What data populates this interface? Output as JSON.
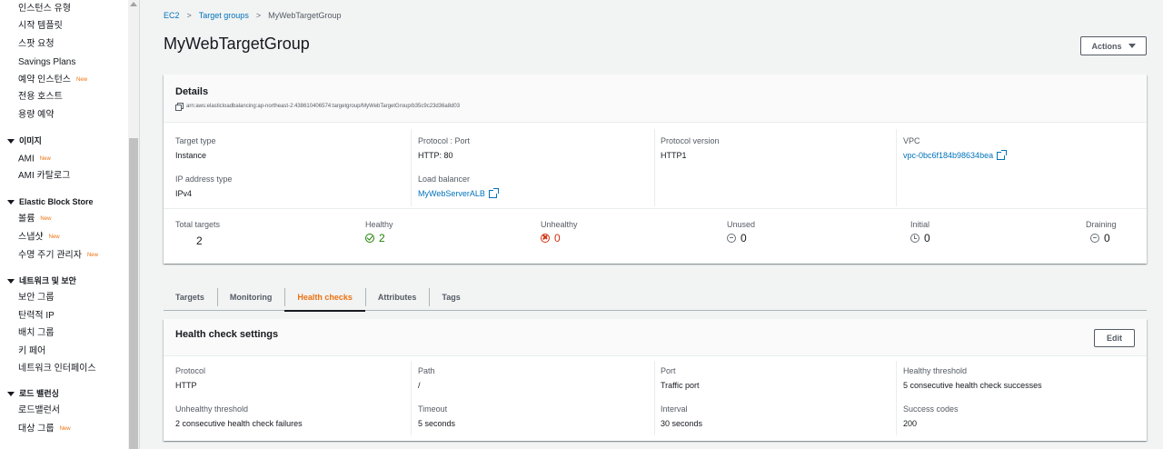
{
  "sidebar": {
    "items_top": [
      {
        "label": "인스턴스 유형",
        "new": ""
      },
      {
        "label": "시작 템플릿",
        "new": ""
      },
      {
        "label": "스팟 요청",
        "new": ""
      },
      {
        "label": "Savings Plans",
        "new": ""
      },
      {
        "label": "예약 인스턴스",
        "new": "New"
      },
      {
        "label": "전용 호스트",
        "new": ""
      },
      {
        "label": "용량 예약",
        "new": ""
      }
    ],
    "section_images": "이미지",
    "images_items": [
      {
        "label": "AMI",
        "new": "New"
      },
      {
        "label": "AMI 카탈로그",
        "new": ""
      }
    ],
    "section_ebs": "Elastic Block Store",
    "ebs_items": [
      {
        "label": "볼륨",
        "new": "New"
      },
      {
        "label": "스냅샷",
        "new": "New"
      },
      {
        "label": "수명 주기 관리자",
        "new": "New"
      }
    ],
    "section_network": "네트워크 및 보안",
    "network_items": [
      {
        "label": "보안 그룹",
        "new": ""
      },
      {
        "label": "탄력적 IP",
        "new": ""
      },
      {
        "label": "배치 그룹",
        "new": ""
      },
      {
        "label": "키 페어",
        "new": ""
      },
      {
        "label": "네트워크 인터페이스",
        "new": ""
      }
    ],
    "section_lb": "로드 밸런싱",
    "lb_items": [
      {
        "label": "로드밸런서",
        "new": ""
      },
      {
        "label": "대상 그룹",
        "new": "New"
      }
    ]
  },
  "breadcrumb": {
    "item1": "EC2",
    "item2": "Target groups",
    "current": "MyWebTargetGroup",
    "separator": ">"
  },
  "page_title": "MyWebTargetGroup",
  "actions_label": "Actions",
  "details": {
    "title": "Details",
    "arn": "arn:aws:elasticloadbalancing:ap-northeast-2:438610406574:targetgroup/MyWebTargetGroup/b35c9c23d36a8d03",
    "target_type_key": "Target type",
    "target_type_val": "Instance",
    "protocol_port_key": "Protocol : Port",
    "protocol_port_val": "HTTP: 80",
    "protocol_version_key": "Protocol version",
    "protocol_version_val": "HTTP1",
    "vpc_key": "VPC",
    "vpc_val": "vpc-0bc6f184b98634bea",
    "ip_type_key": "IP address type",
    "ip_type_val": "IPv4",
    "lb_key": "Load balancer",
    "lb_val": "MyWebServerALB"
  },
  "stats": {
    "total_key": "Total targets",
    "total_val": "2",
    "healthy_key": "Healthy",
    "healthy_val": "2",
    "unhealthy_key": "Unhealthy",
    "unhealthy_val": "0",
    "unused_key": "Unused",
    "unused_val": "0",
    "initial_key": "Initial",
    "initial_val": "0",
    "draining_key": "Draining",
    "draining_val": "0"
  },
  "tabs": [
    "Targets",
    "Monitoring",
    "Health checks",
    "Attributes",
    "Tags"
  ],
  "health": {
    "title": "Health check settings",
    "edit_label": "Edit",
    "protocol_key": "Protocol",
    "protocol_val": "HTTP",
    "path_key": "Path",
    "path_val": "/",
    "port_key": "Port",
    "port_val": "Traffic port",
    "healthy_threshold_key": "Healthy threshold",
    "healthy_threshold_val": "5 consecutive health check successes",
    "unhealthy_threshold_key": "Unhealthy threshold",
    "unhealthy_threshold_val": "2 consecutive health check failures",
    "timeout_key": "Timeout",
    "timeout_val": "5 seconds",
    "interval_key": "Interval",
    "interval_val": "30 seconds",
    "success_codes_key": "Success codes",
    "success_codes_val": "200"
  },
  "colors": {
    "link": "#0073bb",
    "accent": "#ec7211",
    "healthy": "#1d8102",
    "unhealthy": "#d13212"
  }
}
